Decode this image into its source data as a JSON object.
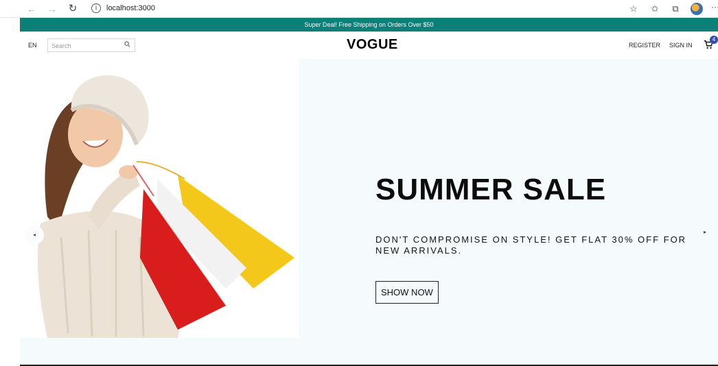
{
  "browser": {
    "back_icon": "←",
    "forward_icon": "→",
    "reload_icon": "↻",
    "info_icon": "i",
    "url": "localhost:3000"
  },
  "announcement": "Super Deal! Free Shipping on Orders Over $50",
  "nav": {
    "language": "EN",
    "search_placeholder": "Search",
    "logo": "VOGUE",
    "register": "REGISTER",
    "sign_in": "SIGN IN",
    "cart_count": "4"
  },
  "hero": {
    "title": "SUMMER SALE",
    "description": "DON'T COMPROMISE ON STYLE! GET FLAT 30% OFF FOR NEW ARRIVALS.",
    "button": "SHOW NOW",
    "prev_arrow": "◂",
    "next_arrow": "▸"
  },
  "colors": {
    "announcement_bg": "#0a8078",
    "hero_bg": "#f5fafd",
    "cart_badge": "#2c4fb3"
  }
}
